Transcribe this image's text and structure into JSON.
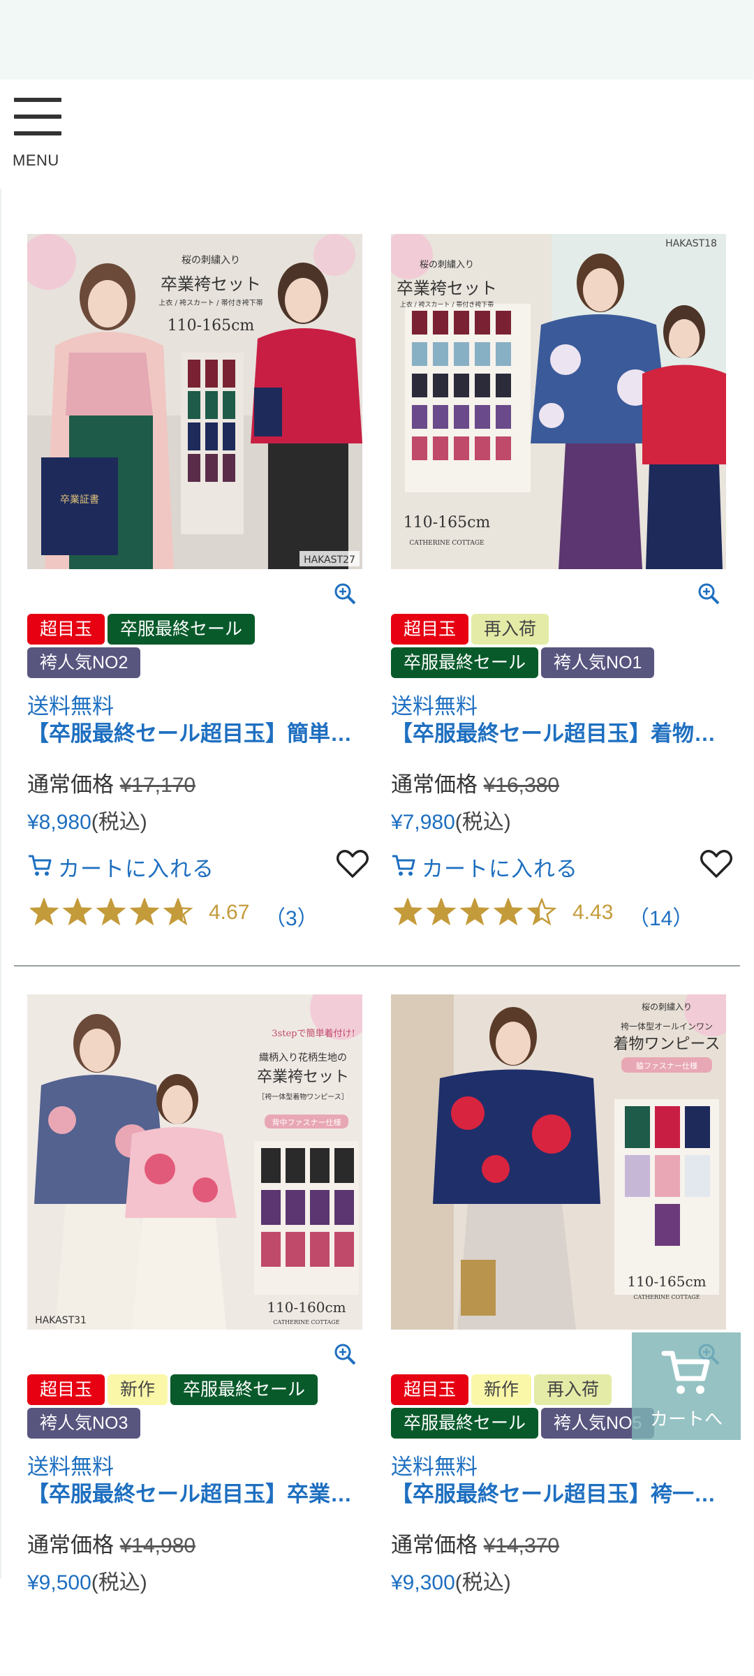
{
  "menu": {
    "label": "MENU"
  },
  "products": [
    {
      "photo_code": "HAKAST27",
      "photo_text": [
        "桜の刺繍入り",
        "卒業袴セット",
        "上衣 / 袴スカート / 帯付き袴下帯",
        "110-165cm",
        "卒業証書"
      ],
      "badges": [
        [
          {
            "text": "超目玉",
            "style": "b-red"
          },
          {
            "text": "卒服最終セール",
            "style": "b-green"
          }
        ],
        [
          {
            "text": "袴人気NO2",
            "style": "b-purple"
          }
        ]
      ],
      "shipping": "送料無料",
      "title": "【卒服最終セール超目玉】簡単着付け",
      "regular_label": "通常価格",
      "regular_price": "¥17,170",
      "sale_price": "¥8,980",
      "tax_label": "(税込)",
      "cart_label": "カートに入れる",
      "rating": 4.67,
      "rating_text": "4.67",
      "review_count": "（3）"
    },
    {
      "photo_code": "HAKAST18",
      "photo_text": [
        "桜の刺繍入り",
        "卒業袴セット",
        "上衣 / 袴スカート / 帯付き袴下帯",
        "110-165cm",
        "CATHERINE COTTAGE"
      ],
      "badges": [
        [
          {
            "text": "超目玉",
            "style": "b-red"
          },
          {
            "text": "再入荷",
            "style": "b-lime"
          }
        ],
        [
          {
            "text": "卒服最終セール",
            "style": "b-green"
          },
          {
            "text": "袴人気NO1",
            "style": "b-purple"
          }
        ]
      ],
      "shipping": "送料無料",
      "title": "【卒服最終セール超目玉】着物と袴",
      "regular_label": "通常価格",
      "regular_price": "¥16,380",
      "sale_price": "¥7,980",
      "tax_label": "(税込)",
      "cart_label": "カートに入れる",
      "rating": 4.43,
      "rating_text": "4.43",
      "review_count": "（14）"
    },
    {
      "photo_code": "HAKAST31",
      "photo_text": [
        "3stepで簡単着付け!",
        "織柄入り花柄生地の",
        "卒業袴セット",
        "［袴一体型着物ワンピース］",
        "背中ファスナー仕様",
        "110-160cm",
        "CATHERINE COTTAGE"
      ],
      "badges": [
        [
          {
            "text": "超目玉",
            "style": "b-red"
          },
          {
            "text": "新作",
            "style": "b-yellow"
          },
          {
            "text": "卒服最終セール",
            "style": "b-green"
          }
        ],
        [
          {
            "text": "袴人気NO3",
            "style": "b-purple"
          }
        ]
      ],
      "shipping": "送料無料",
      "title": "【卒服最終セール超目玉】卒業袴セット",
      "regular_label": "通常価格",
      "regular_price": "¥14,980",
      "sale_price": "¥9,500",
      "tax_label": "(税込)"
    },
    {
      "photo_code": "",
      "photo_text": [
        "桜の刺繍入り",
        "袴一体型オールインワン",
        "着物ワンピース",
        "脇ファスナー仕様",
        "110-165cm",
        "CATHERINE COTTAGE"
      ],
      "badges": [
        [
          {
            "text": "超目玉",
            "style": "b-red"
          },
          {
            "text": "新作",
            "style": "b-yellow"
          },
          {
            "text": "再入荷",
            "style": "b-lime"
          }
        ],
        [
          {
            "text": "卒服最終セール",
            "style": "b-green"
          },
          {
            "text": "袴人気NO5",
            "style": "b-purple"
          }
        ]
      ],
      "shipping": "送料無料",
      "title": "【卒服最終セール超目玉】袴一体型",
      "regular_label": "通常価格",
      "regular_price": "¥14,370",
      "sale_price": "¥9,300",
      "tax_label": "(税込)"
    }
  ],
  "floating_cart": {
    "label": "カートへ"
  },
  "colors": {
    "link_blue": "#1e6fc0",
    "star_gold": "#c49b3b",
    "badge_red": "#e60012",
    "badge_green": "#085a2a",
    "badge_purple": "#58557f"
  }
}
